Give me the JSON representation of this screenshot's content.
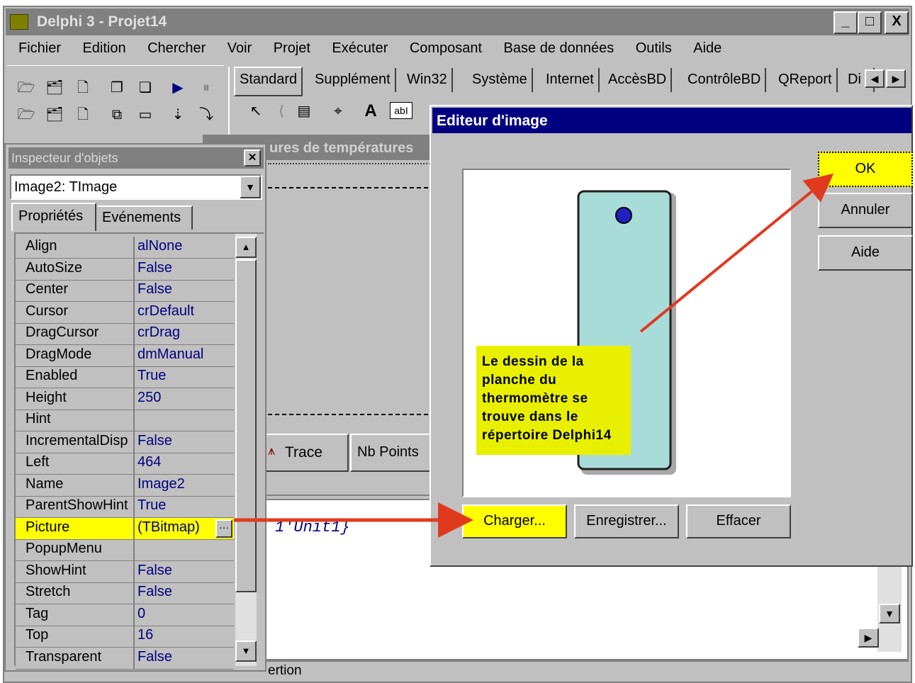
{
  "window": {
    "title": "Delphi 3 - Projet14",
    "controls": [
      "_",
      "□",
      "X"
    ]
  },
  "menu": [
    "Fichier",
    "Edition",
    "Chercher",
    "Voir",
    "Projet",
    "Exécuter",
    "Composant",
    "Base de données",
    "Outils",
    "Aide"
  ],
  "palette_tabs": [
    "Standard",
    "Supplément",
    "Win32",
    "Système",
    "Internet",
    "AccèsBD",
    "ContrôleBD",
    "QReport",
    "Di"
  ],
  "form": {
    "title_fragment": "ures de températures",
    "trace_label": "Trace",
    "nb_points_label": "Nb Points"
  },
  "code": {
    "fragment": "1'Unit1}",
    "status_fragment": "ertion"
  },
  "inspector": {
    "title": "Inspecteur d'objets",
    "object": "Image2: TImage",
    "tabs": [
      "Propriétés",
      "Evénements"
    ],
    "properties": [
      {
        "name": "Align",
        "value": "alNone"
      },
      {
        "name": "AutoSize",
        "value": "False"
      },
      {
        "name": "Center",
        "value": "False"
      },
      {
        "name": "Cursor",
        "value": "crDefault"
      },
      {
        "name": "DragCursor",
        "value": "crDrag"
      },
      {
        "name": "DragMode",
        "value": "dmManual"
      },
      {
        "name": "Enabled",
        "value": "True"
      },
      {
        "name": "Height",
        "value": "250"
      },
      {
        "name": "Hint",
        "value": ""
      },
      {
        "name": "IncrementalDisp",
        "value": "False"
      },
      {
        "name": "Left",
        "value": "464"
      },
      {
        "name": "Name",
        "value": "Image2"
      },
      {
        "name": "ParentShowHint",
        "value": "True"
      },
      {
        "name": "Picture",
        "value": "(TBitmap)"
      },
      {
        "name": "PopupMenu",
        "value": ""
      },
      {
        "name": "ShowHint",
        "value": "False"
      },
      {
        "name": "Stretch",
        "value": "False"
      },
      {
        "name": "Tag",
        "value": "0"
      },
      {
        "name": "Top",
        "value": "16"
      },
      {
        "name": "Transparent",
        "value": "False"
      }
    ],
    "selected_property": "Picture"
  },
  "image_editor": {
    "title": "Editeur d'image",
    "buttons": {
      "ok": "OK",
      "cancel": "Annuler",
      "help": "Aide",
      "load": "Charger...",
      "save": "Enregistrer...",
      "clear": "Effacer"
    },
    "annotation": "Le dessin de la planche du thermomètre se trouve dans le répertoire Delphi14"
  },
  "colors": {
    "title_active": "#000080",
    "highlight": "#ffff00",
    "arrow": "#e03a1e",
    "thermo_board": "#a8dcd8"
  }
}
